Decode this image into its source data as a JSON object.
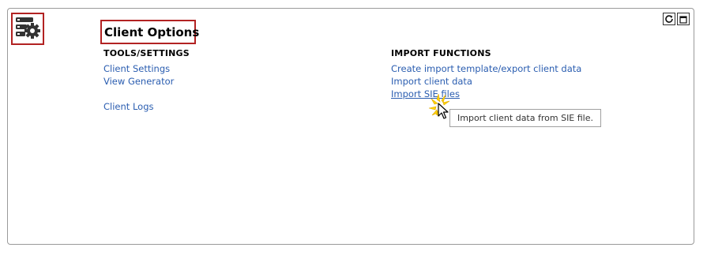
{
  "header": {
    "title": "Client Options",
    "app_icon": "server-settings-icon"
  },
  "window_controls": {
    "refresh_icon": "refresh-icon",
    "maximize_icon": "maximize-icon"
  },
  "tools_section": {
    "heading": "TOOLS/SETTINGS",
    "items": [
      {
        "label": "Client Settings"
      },
      {
        "label": "View Generator"
      },
      {
        "label": "Client Logs"
      }
    ]
  },
  "import_section": {
    "heading": "IMPORT FUNCTIONS",
    "items": [
      {
        "label": "Create import template/export client data"
      },
      {
        "label": "Import client data"
      },
      {
        "label": "Import SIE files"
      }
    ]
  },
  "tooltip": {
    "text": "Import client data from SIE file."
  },
  "colors": {
    "link": "#2a5db0",
    "highlight_border": "#b22222",
    "cursor_highlight": "#ffd400"
  }
}
